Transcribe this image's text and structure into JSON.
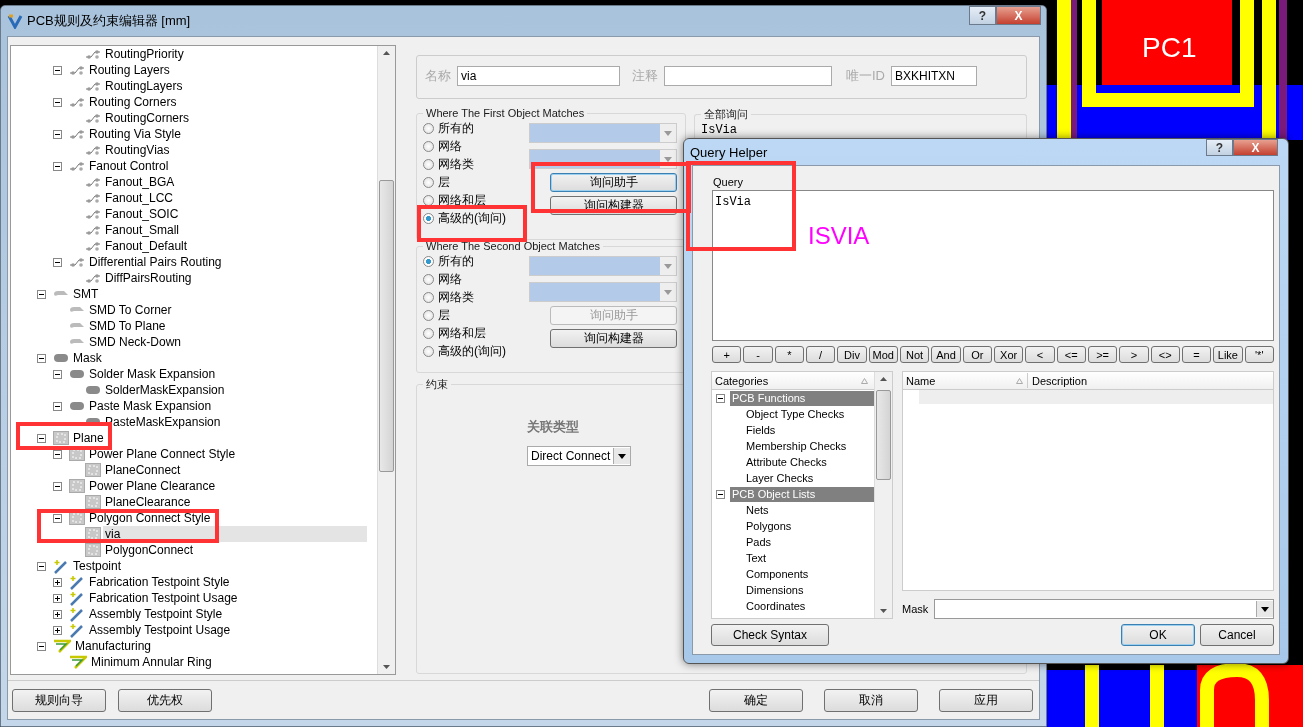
{
  "window": {
    "title": "PCB规则及约束编辑器 [mm]",
    "controls": [
      "?",
      "X"
    ]
  },
  "tree": [
    {
      "children": [
        {
          "children": [
            {
              "label": "RoutingPriority",
              "kind": "routing",
              "selected": false
            }
          ]
        },
        {
          "label": "Routing Layers",
          "kind": "routing",
          "expanded": true,
          "selected": false,
          "children": [
            {
              "label": "RoutingLayers",
              "kind": "routing",
              "selected": false
            }
          ]
        },
        {
          "label": "Routing Corners",
          "kind": "routing",
          "expanded": true,
          "selected": false,
          "children": [
            {
              "label": "RoutingCorners",
              "kind": "routing",
              "selected": false
            }
          ]
        },
        {
          "label": "Routing Via Style",
          "kind": "routing",
          "expanded": true,
          "selected": false,
          "children": [
            {
              "label": "RoutingVias",
              "kind": "routing",
              "selected": false
            }
          ]
        },
        {
          "label": "Fanout Control",
          "kind": "routing",
          "expanded": true,
          "selected": false,
          "children": [
            {
              "label": "Fanout_BGA",
              "kind": "routing",
              "selected": false
            },
            {
              "label": "Fanout_LCC",
              "kind": "routing",
              "selected": false
            },
            {
              "label": "Fanout_SOIC",
              "kind": "routing",
              "selected": false
            },
            {
              "label": "Fanout_Small",
              "kind": "routing",
              "selected": false
            },
            {
              "label": "Fanout_Default",
              "kind": "routing",
              "selected": false
            }
          ]
        },
        {
          "label": "Differential Pairs Routing",
          "kind": "routing",
          "expanded": true,
          "selected": false,
          "children": [
            {
              "label": "DiffPairsRouting",
              "kind": "routing",
              "selected": false
            }
          ]
        }
      ]
    },
    {
      "label": "SMT",
      "kind": "smt",
      "expanded": true,
      "selected": false,
      "children": [
        {
          "label": "SMD To Corner",
          "kind": "smt",
          "selected": false
        },
        {
          "label": "SMD To Plane",
          "kind": "smt",
          "selected": false
        },
        {
          "label": "SMD Neck-Down",
          "kind": "smt",
          "selected": false
        }
      ]
    },
    {
      "label": "Mask",
      "kind": "mask",
      "expanded": true,
      "selected": false,
      "children": [
        {
          "label": "Solder Mask Expansion",
          "kind": "mask",
          "expanded": true,
          "selected": false,
          "children": [
            {
              "label": "SolderMaskExpansion",
              "kind": "mask",
              "selected": false
            }
          ]
        },
        {
          "label": "Paste Mask Expansion",
          "kind": "mask",
          "expanded": true,
          "selected": false,
          "children": [
            {
              "label": "PasteMaskExpansion",
              "kind": "mask",
              "selected": false
            }
          ]
        }
      ]
    },
    {
      "label": "Plane",
      "kind": "plane",
      "expanded": true,
      "selected": false,
      "children": [
        {
          "label": "Power Plane Connect Style",
          "kind": "plane",
          "expanded": true,
          "selected": false,
          "children": [
            {
              "label": "PlaneConnect",
              "kind": "plane",
              "selected": false
            }
          ]
        },
        {
          "label": "Power Plane Clearance",
          "kind": "plane",
          "expanded": true,
          "selected": false,
          "children": [
            {
              "label": "PlaneClearance",
              "kind": "plane",
              "selected": false
            }
          ]
        },
        {
          "label": "Polygon Connect Style",
          "kind": "plane",
          "expanded": true,
          "selected": false,
          "children": [
            {
              "label": "via",
              "kind": "plane",
              "selected": true
            },
            {
              "label": "PolygonConnect",
              "kind": "plane",
              "selected": false
            }
          ]
        }
      ]
    },
    {
      "label": "Testpoint",
      "kind": "testpoint",
      "expanded": true,
      "selected": false,
      "children": [
        {
          "label": "Fabrication Testpoint Style",
          "kind": "testpoint",
          "expanded": false,
          "selected": false
        },
        {
          "label": "Fabrication Testpoint Usage",
          "kind": "testpoint",
          "expanded": false,
          "selected": false
        },
        {
          "label": "Assembly Testpoint Style",
          "kind": "testpoint",
          "expanded": false,
          "selected": false
        },
        {
          "label": "Assembly Testpoint Usage",
          "kind": "testpoint",
          "expanded": false,
          "selected": false
        }
      ]
    },
    {
      "label": "Manufacturing",
      "kind": "manufacturing",
      "expanded": true,
      "selected": false,
      "children": [
        {
          "label": "Minimum Annular Ring",
          "kind": "manufacturing",
          "selected": false
        }
      ]
    }
  ],
  "rule": {
    "fields": [
      {
        "label": "名称",
        "value": "via"
      },
      {
        "label": "注释"
      },
      {
        "label": "唯一ID",
        "value": "BXKHITXN"
      }
    ],
    "groups": [
      {
        "title": "Where The First Object Matches",
        "options": [
          {
            "label": "所有的",
            "selected": false
          },
          {
            "label": "网络",
            "selected": false
          },
          {
            "label": "网络类",
            "selected": false
          },
          {
            "label": "层",
            "selected": false
          },
          {
            "label": "网络和层",
            "selected": false
          },
          {
            "label": "高级的(询问)",
            "selected": true
          }
        ],
        "buttons": [
          {
            "label": "询问助手",
            "disabled": false,
            "focused": true
          },
          {
            "label": "询问构建器",
            "disabled": false,
            "focused": false
          }
        ]
      },
      {
        "title": "Where The Second Object Matches",
        "options": [
          {
            "label": "所有的",
            "selected": true
          },
          {
            "label": "网络",
            "selected": false
          },
          {
            "label": "网络类",
            "selected": false
          },
          {
            "label": "层",
            "selected": false
          },
          {
            "label": "网络和层",
            "selected": false
          },
          {
            "label": "高级的(询问)",
            "selected": false
          }
        ],
        "buttons": [
          {
            "label": "询问助手",
            "disabled": true,
            "focused": false
          },
          {
            "label": "询问构建器",
            "disabled": false,
            "focused": false
          }
        ]
      }
    ],
    "full_query": {
      "title": "全部询问",
      "value": "IsVia"
    },
    "constraints": {
      "title": "约束",
      "label": "关联类型",
      "value": "Direct Connect"
    }
  },
  "footer": {
    "left_buttons": [
      "规则向导",
      "优先权"
    ],
    "right_buttons": [
      "确定",
      "取消",
      "应用"
    ]
  },
  "query_helper": {
    "title": "Query Helper",
    "controls": [
      "?",
      "X"
    ],
    "query_label": "Query",
    "query": "IsVia",
    "operators": [
      "+",
      "-",
      "*",
      "/",
      "Div",
      "Mod",
      "Not",
      "And",
      "Or",
      "Xor",
      "<",
      "<=",
      ">=",
      ">",
      "<>",
      "=",
      "Like",
      "'*'"
    ],
    "categories_header": "Categories",
    "categories": [
      {
        "label": "PCB Functions",
        "expanded": true,
        "children": [
          {
            "label": "Object Type Checks"
          },
          {
            "label": "Fields"
          },
          {
            "label": "Membership Checks"
          },
          {
            "label": "Attribute Checks"
          },
          {
            "label": "Layer Checks"
          }
        ]
      },
      {
        "label": "PCB Object Lists",
        "expanded": true,
        "children": [
          {
            "label": "Nets"
          },
          {
            "label": "Polygons"
          },
          {
            "label": "Pads"
          },
          {
            "label": "Text"
          },
          {
            "label": "Components"
          },
          {
            "label": "Dimensions"
          },
          {
            "label": "Coordinates"
          }
        ]
      }
    ],
    "columns": [
      "Name",
      "Description"
    ],
    "mask_label": "Mask",
    "buttons": [
      {
        "label": "Check Syntax",
        "default": false
      },
      {
        "label": "OK",
        "default": true
      },
      {
        "label": "Cancel",
        "default": false
      }
    ]
  },
  "pcb_view": {
    "label": "PC1"
  },
  "annotation": "ISVIA"
}
